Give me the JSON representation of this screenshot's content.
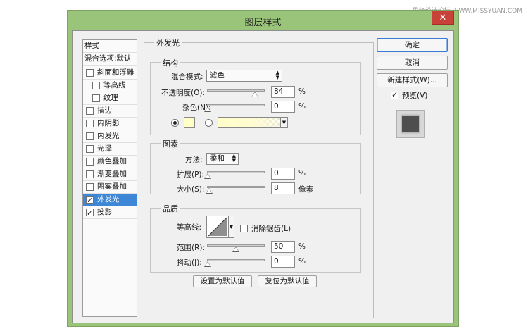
{
  "watermark": "思缘设计论坛 WWW.MISSYUAN.COM",
  "window": {
    "title": "图层样式",
    "close_label": "✕"
  },
  "style_list": {
    "header": "样式",
    "blend_options": "混合选项:默认",
    "items": [
      {
        "label": "斜面和浮雕",
        "checked": false
      },
      {
        "label": "等高线",
        "checked": false
      },
      {
        "label": "纹理",
        "checked": false
      },
      {
        "label": "描边",
        "checked": false
      },
      {
        "label": "内阴影",
        "checked": false
      },
      {
        "label": "内发光",
        "checked": false
      },
      {
        "label": "光泽",
        "checked": false
      },
      {
        "label": "颜色叠加",
        "checked": false
      },
      {
        "label": "渐变叠加",
        "checked": false
      },
      {
        "label": "图案叠加",
        "checked": false
      },
      {
        "label": "外发光",
        "checked": true,
        "selected": true
      },
      {
        "label": "投影",
        "checked": true
      }
    ]
  },
  "outer_glow": {
    "title": "外发光",
    "structure": {
      "title": "结构",
      "blend_mode_label": "混合模式:",
      "blend_mode_value": "滤色",
      "opacity_label": "不透明度(O):",
      "opacity_value": "84",
      "opacity_unit": "%",
      "opacity_level": 0.84,
      "noise_label": "杂色(N):",
      "noise_value": "0",
      "noise_unit": "%",
      "noise_level": 0,
      "color_swatch": "#ffffc8",
      "solid_radio_selected": true
    },
    "elements": {
      "title": "图素",
      "method_label": "方法:",
      "method_value": "柔和",
      "spread_label": "扩展(P):",
      "spread_value": "0",
      "spread_unit": "%",
      "spread_level": 0,
      "size_label": "大小(S):",
      "size_value": "8",
      "size_unit": "像素",
      "size_level": 0.03
    },
    "quality": {
      "title": "品质",
      "contour_label": "等高线:",
      "antialias_label": "消除锯齿(L)",
      "antialias_checked": false,
      "range_label": "范围(R):",
      "range_value": "50",
      "range_unit": "%",
      "range_level": 0.5,
      "jitter_label": "抖动(J):",
      "jitter_value": "0",
      "jitter_unit": "%",
      "jitter_level": 0
    },
    "set_default_label": "设置为默认值",
    "reset_default_label": "复位为默认值"
  },
  "buttons": {
    "ok": "确定",
    "cancel": "取消",
    "new_style": "新建样式(W)...",
    "preview_label": "预览(V)",
    "preview_checked": true
  },
  "colors": {
    "window_frame": "#9ac47a",
    "selection": "#3d87d6",
    "close": "#c8423a"
  }
}
